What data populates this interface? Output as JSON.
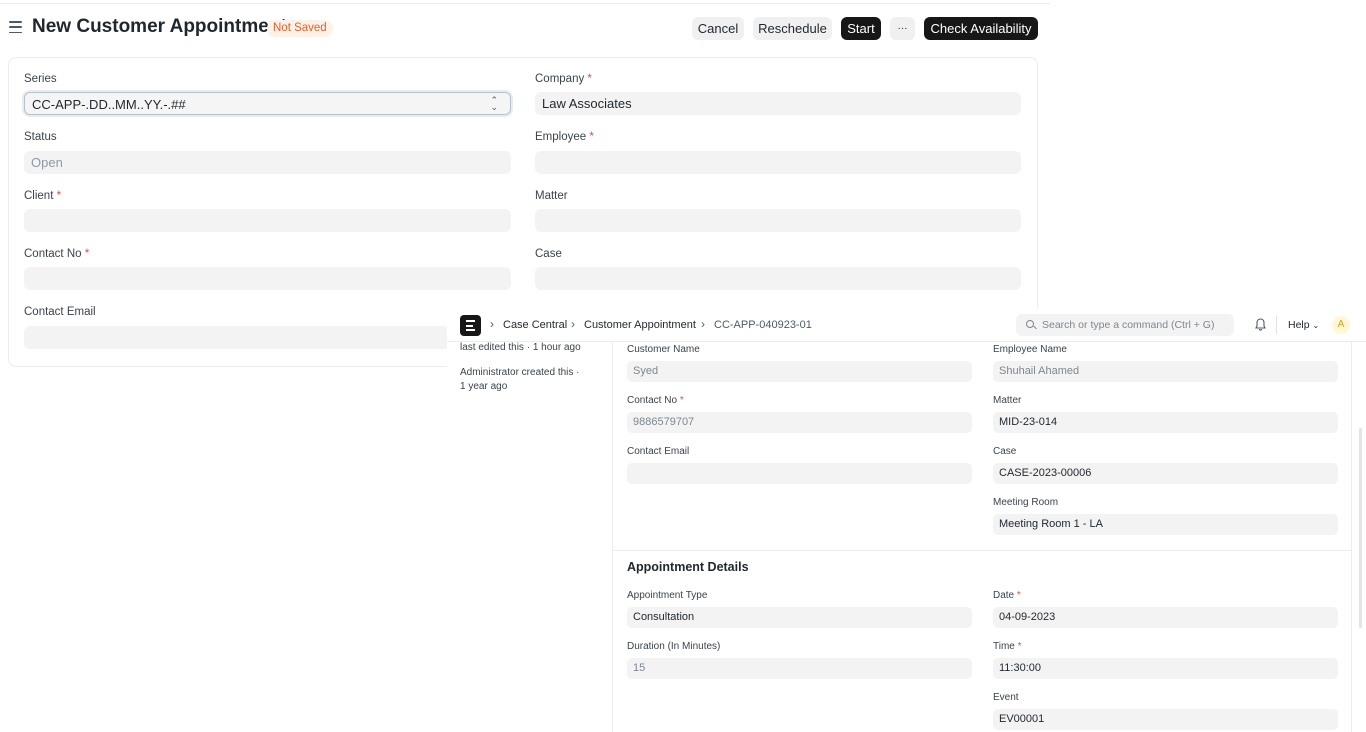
{
  "header": {
    "title": "New Customer Appointment",
    "status_badge": "Not Saved",
    "cancel_label": "Cancel",
    "reschedule_label": "Reschedule",
    "start_label": "Start",
    "more_label": "···",
    "check_availability_label": "Check Availability"
  },
  "form": {
    "series": {
      "label": "Series",
      "value": "CC-APP-.DD..MM..YY.-.##"
    },
    "company": {
      "label": "Company",
      "value": "Law Associates"
    },
    "status": {
      "label": "Status",
      "value": "Open"
    },
    "employee": {
      "label": "Employee",
      "value": ""
    },
    "client": {
      "label": "Client",
      "value": ""
    },
    "matter": {
      "label": "Matter",
      "value": ""
    },
    "contact_no": {
      "label": "Contact No",
      "value": ""
    },
    "case": {
      "label": "Case",
      "value": ""
    },
    "contact_email": {
      "label": "Contact Email",
      "value": ""
    },
    "required_mark": "*"
  },
  "overlay": {
    "nav": {
      "breadcrumbs": [
        "Case Central",
        "Customer Appointment",
        "CC-APP-040923-01"
      ],
      "search_placeholder": "Search or type a command (Ctrl + G)",
      "help_label": "Help",
      "avatar_letter": "A"
    },
    "timeline": {
      "edited": "last edited this · 1 hour ago",
      "created_line1": "Administrator created this ·",
      "created_line2": "1 year ago"
    },
    "fields": {
      "customer_name": {
        "label": "Customer Name",
        "value": "Syed"
      },
      "employee_name": {
        "label": "Employee Name",
        "value": "Shuhail Ahamed"
      },
      "contact_no": {
        "label": "Contact No",
        "value": "9886579707"
      },
      "matter": {
        "label": "Matter",
        "value": "MID-23-014"
      },
      "contact_email": {
        "label": "Contact Email",
        "value": ""
      },
      "case": {
        "label": "Case",
        "value": "CASE-2023-00006"
      },
      "meeting_room": {
        "label": "Meeting Room",
        "value": "Meeting Room 1 - LA"
      }
    },
    "appointment_details": {
      "title": "Appointment Details",
      "appointment_type": {
        "label": "Appointment Type",
        "value": "Consultation"
      },
      "date": {
        "label": "Date",
        "value": "04-09-2023"
      },
      "duration": {
        "label": "Duration (In Minutes)",
        "value": "15"
      },
      "time": {
        "label": "Time",
        "value": "11:30:00"
      },
      "event": {
        "label": "Event",
        "value": "EV00001"
      }
    }
  }
}
